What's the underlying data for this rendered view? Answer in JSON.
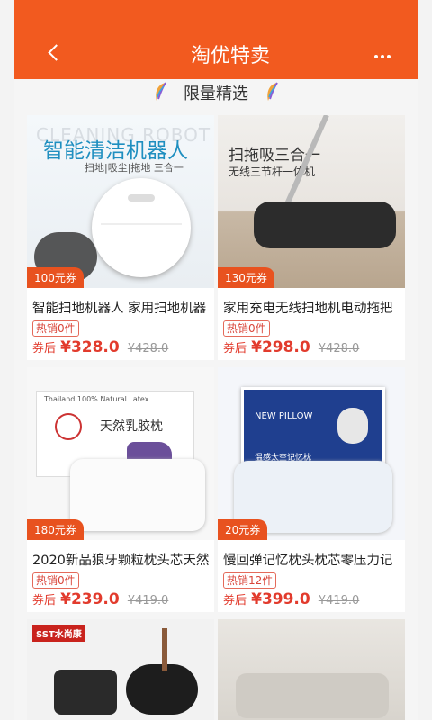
{
  "header": {
    "title": "淘优特卖"
  },
  "section": {
    "title": "限量精选"
  },
  "products": [
    {
      "name": "智能扫地机器人 家用扫地机器",
      "coupon": "100元券",
      "hot": "热销0件",
      "after": "券后",
      "price": "¥328.0",
      "orig": "¥428.0",
      "img_text": {
        "brand": "CLEANING ROBOT",
        "headline": "智能清洁机器人",
        "sub": "扫地|吸尘|拖地 三合一"
      }
    },
    {
      "name": "家用充电无线扫地机电动拖把",
      "coupon": "130元券",
      "hot": "热销0件",
      "after": "券后",
      "price": "¥298.0",
      "orig": "¥428.0",
      "img_text": {
        "headline": "扫拖吸三合一",
        "sub": "无线三节杆一体机"
      }
    },
    {
      "name": "2020新品狼牙颗粒枕头芯天然",
      "coupon": "180元券",
      "hot": "热销0件",
      "after": "券后",
      "price": "¥239.0",
      "orig": "¥419.0",
      "img_text": {
        "box": "天然乳胶枕",
        "small": "Thailand 100% Natural Latex"
      }
    },
    {
      "name": "慢回弹记忆枕头枕芯零压力记",
      "coupon": "20元券",
      "hot": "热销12件",
      "after": "券后",
      "price": "¥399.0",
      "orig": "¥419.0",
      "img_text": {
        "box": "NEW PILLOW",
        "sub": "温感太空记忆枕"
      }
    },
    {
      "name": "",
      "coupon": "",
      "img_text": {
        "badge": "SST水尚康"
      }
    },
    {
      "name": "",
      "coupon": ""
    }
  ]
}
